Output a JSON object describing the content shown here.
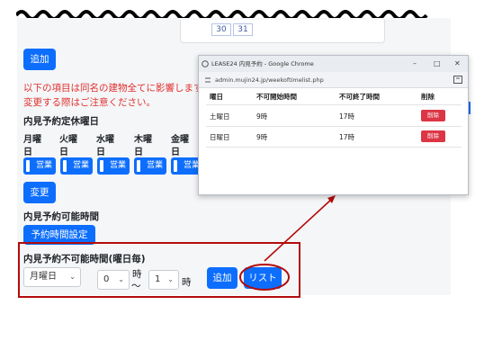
{
  "calendar": {
    "cells": [
      "30",
      "31"
    ]
  },
  "add_label": "追加",
  "warning": {
    "line1": "以下の項目は同名の建物全てに影響します。",
    "line2": "変更する際はご注意ください。"
  },
  "holiday_section": {
    "title": "内見予約定休曜日",
    "days_top": [
      "月曜",
      "火曜",
      "水曜",
      "木曜",
      "金曜"
    ],
    "days_bottom": [
      "日",
      "日",
      "日",
      "日",
      "日"
    ],
    "toggle_label": "営業",
    "change_label": "変更"
  },
  "available_section": {
    "title": "内見予約可能時間",
    "set_button": "予約時間設定"
  },
  "unavailable_section": {
    "title": "内見予約不可能時間(曜日毎)",
    "weekday_value": "月曜日",
    "hour_from_value": "0",
    "hour_unit": "時",
    "tilde": "〜",
    "hour_to_value": "1",
    "add_button": "追加",
    "list_button": "リスト"
  },
  "popup": {
    "title": "LEASE24 内見予約 - Google Chrome",
    "url": "admin.mujin24.jp/weekoftimelist.php",
    "headers": [
      "曜日",
      "不可開始時間",
      "不可終了時間",
      "削除"
    ],
    "rows": [
      {
        "day": "土曜日",
        "start": "9時",
        "end": "17時",
        "delete": "削除"
      },
      {
        "day": "日曜日",
        "start": "9時",
        "end": "17時",
        "delete": "削除"
      }
    ]
  },
  "colors": {
    "primary": "#0d6efd",
    "warning_text": "#e0312f",
    "annotation_red": "#b30c0c",
    "delete_red": "#dc3545"
  }
}
